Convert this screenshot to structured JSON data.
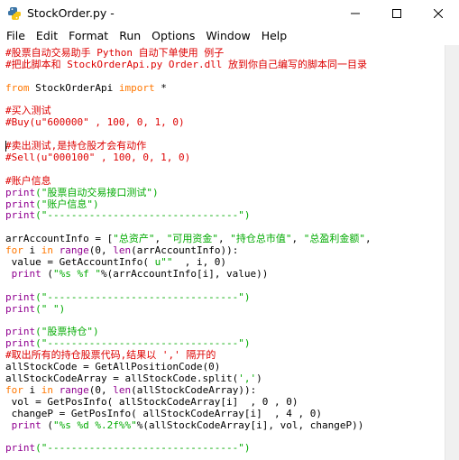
{
  "window": {
    "title": "StockOrder.py -",
    "controls": {
      "minimize": "—",
      "maximize": "☐",
      "close": "✕"
    }
  },
  "menubar": {
    "items": [
      "File",
      "Edit",
      "Format",
      "Run",
      "Options",
      "Window",
      "Help"
    ]
  },
  "colors": {
    "comment": "#dd0000",
    "keyword": "#ff7700",
    "string": "#00aa00",
    "builtin": "#900090",
    "plain": "#000000"
  },
  "editor": {
    "lines": [
      [
        [
          "comment",
          "#股票自动交易助手 Python 自动下单使用 例子"
        ]
      ],
      [
        [
          "comment",
          "#把此脚本和 StockOrderApi.py Order.dll 放到你自己编写的脚本同一目录"
        ]
      ],
      [],
      [
        [
          "keyword",
          "from"
        ],
        [
          "plain",
          " StockOrderApi "
        ],
        [
          "keyword",
          "import"
        ],
        [
          "plain",
          " *"
        ]
      ],
      [],
      [
        [
          "comment",
          "#买入测试"
        ]
      ],
      [
        [
          "comment",
          "#Buy(u\"600000\" , 100, 0, 1, 0)"
        ]
      ],
      [],
      [
        [
          "comment",
          "#卖出测试,是持仓股才会有动作"
        ]
      ],
      [
        [
          "comment",
          "#Sell(u\"000100\" , 100, 0, 1, 0)"
        ]
      ],
      [],
      [
        [
          "comment",
          "#账户信息"
        ]
      ],
      [
        [
          "builtin",
          "print"
        ],
        [
          "string",
          "(\"股票自动交易接口测试\")"
        ]
      ],
      [
        [
          "builtin",
          "print"
        ],
        [
          "string",
          "(\"账户信息\")"
        ]
      ],
      [
        [
          "builtin",
          "print"
        ],
        [
          "string",
          "(\"--------------------------------\")"
        ]
      ],
      [],
      [
        [
          "plain",
          "arrAccountInfo = ["
        ],
        [
          "string",
          "\"总资产\""
        ],
        [
          "plain",
          ", "
        ],
        [
          "string",
          "\"可用资金\""
        ],
        [
          "plain",
          ", "
        ],
        [
          "string",
          "\"持仓总市值\""
        ],
        [
          "plain",
          ", "
        ],
        [
          "string",
          "\"总盈利金额\""
        ],
        [
          "plain",
          ","
        ]
      ],
      [
        [
          "keyword",
          "for"
        ],
        [
          "plain",
          " i "
        ],
        [
          "keyword",
          "in"
        ],
        [
          "plain",
          " "
        ],
        [
          "builtin",
          "range"
        ],
        [
          "plain",
          "(0, "
        ],
        [
          "builtin",
          "len"
        ],
        [
          "plain",
          "(arrAccountInfo)):"
        ]
      ],
      [
        [
          "plain",
          " value = GetAccountInfo( "
        ],
        [
          "string",
          "u\"\""
        ],
        [
          "plain",
          "  , i, 0)"
        ]
      ],
      [
        [
          "plain",
          " "
        ],
        [
          "builtin",
          "print"
        ],
        [
          "plain",
          " ("
        ],
        [
          "string",
          "\"%s %f \""
        ],
        [
          "plain",
          "%(arrAccountInfo[i], value))"
        ]
      ],
      [],
      [
        [
          "builtin",
          "print"
        ],
        [
          "string",
          "(\"--------------------------------\")"
        ]
      ],
      [
        [
          "builtin",
          "print"
        ],
        [
          "string",
          "(\" \")"
        ]
      ],
      [],
      [
        [
          "builtin",
          "print"
        ],
        [
          "string",
          "(\"股票持仓\")"
        ]
      ],
      [
        [
          "builtin",
          "print"
        ],
        [
          "string",
          "(\"--------------------------------\")"
        ]
      ],
      [
        [
          "comment",
          "#取出所有的持仓股票代码,结果以 ',' 隔开的"
        ]
      ],
      [
        [
          "plain",
          "allStockCode = GetAllPositionCode(0)"
        ]
      ],
      [
        [
          "plain",
          "allStockCodeArray = allStockCode.split("
        ],
        [
          "string",
          "','"
        ],
        [
          "plain",
          ")"
        ]
      ],
      [
        [
          "keyword",
          "for"
        ],
        [
          "plain",
          " i "
        ],
        [
          "keyword",
          "in"
        ],
        [
          "plain",
          " "
        ],
        [
          "builtin",
          "range"
        ],
        [
          "plain",
          "(0, "
        ],
        [
          "builtin",
          "len"
        ],
        [
          "plain",
          "(allStockCodeArray)):"
        ]
      ],
      [
        [
          "plain",
          " vol = GetPosInfo( allStockCodeArray[i]  , 0 , 0)"
        ]
      ],
      [
        [
          "plain",
          " changeP = GetPosInfo( allStockCodeArray[i]  , 4 , 0)"
        ]
      ],
      [
        [
          "plain",
          " "
        ],
        [
          "builtin",
          "print"
        ],
        [
          "plain",
          " ("
        ],
        [
          "string",
          "\"%s %d %.2f%%\""
        ],
        [
          "plain",
          "%(allStockCodeArray[i], vol, changeP))"
        ]
      ],
      [],
      [
        [
          "builtin",
          "print"
        ],
        [
          "string",
          "(\"--------------------------------\")"
        ]
      ]
    ]
  }
}
